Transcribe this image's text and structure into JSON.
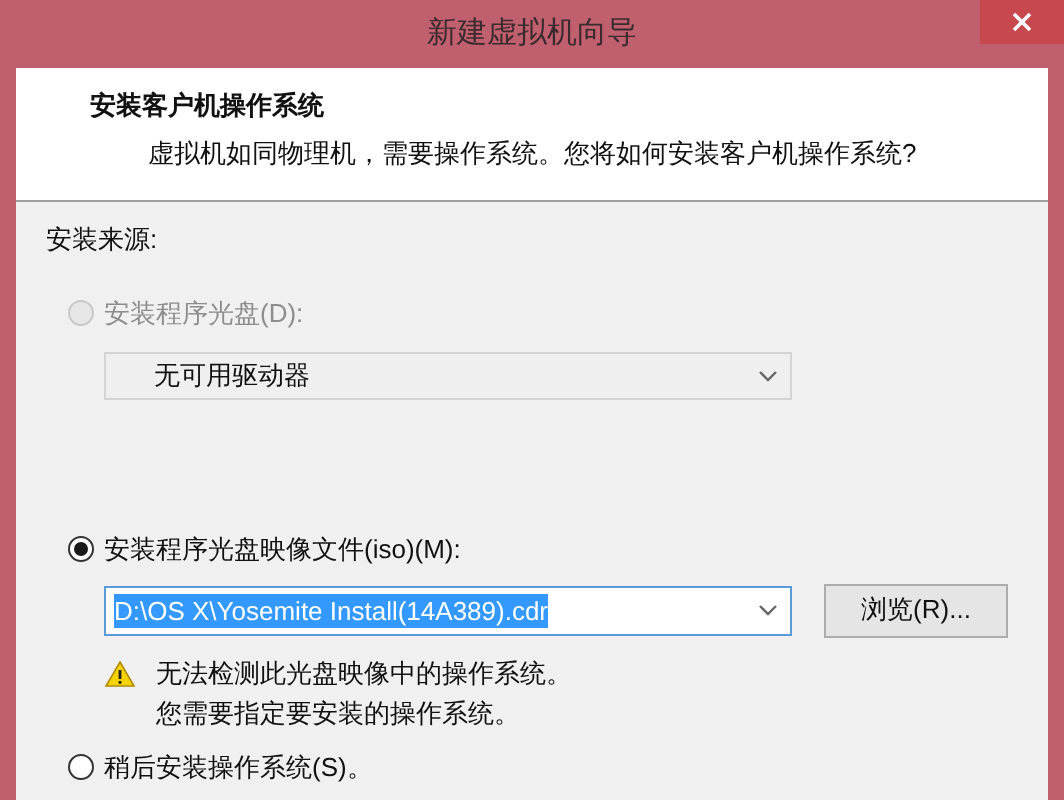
{
  "window": {
    "title": "新建虚拟机向导"
  },
  "header": {
    "title": "安装客户机操作系统",
    "subtitle": "虚拟机如同物理机，需要操作系统。您将如何安装客户机操作系统?"
  },
  "source_label": "安装来源:",
  "options": [
    {
      "kind": "drive",
      "label": "安装程序光盘(D):",
      "selected": false,
      "disabled": true,
      "dropdown": {
        "value": "无可用驱动器",
        "disabled": true
      }
    },
    {
      "kind": "image",
      "label": "安装程序光盘映像文件(iso)(M):",
      "selected": true,
      "disabled": false,
      "combo": {
        "value": "D:\\OS X\\Yosemite Install(14A389).cdr",
        "highlighted": true
      },
      "browse_button": "浏览(R)...",
      "warning": [
        "无法检测此光盘映像中的操作系统。",
        "您需要指定要安装的操作系统。"
      ]
    },
    {
      "kind": "later",
      "label": "稍后安装操作系统(S)。",
      "selected": false,
      "disabled": false
    }
  ]
}
